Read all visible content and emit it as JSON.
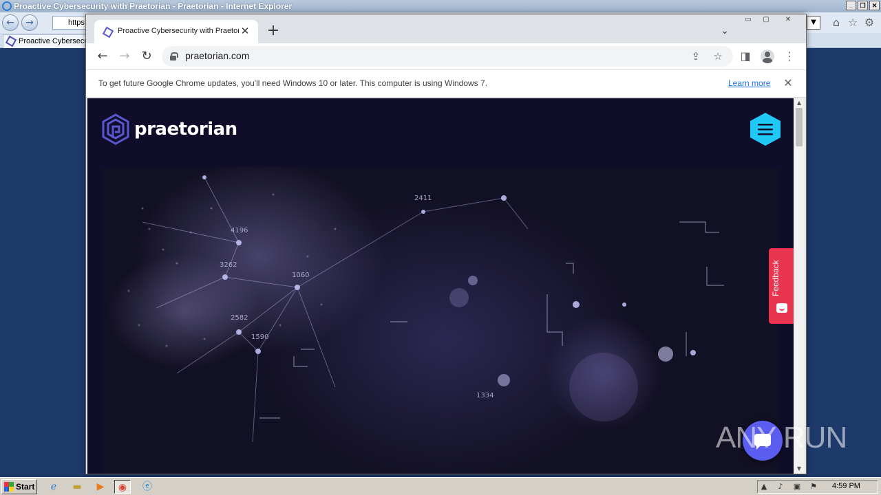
{
  "ie": {
    "title": "Proactive Cybersecurity with Praetorian - Praetorian - Internet Explorer",
    "address_value": "https",
    "tab_label": "Proactive Cybersecurity with Praetorian"
  },
  "chrome": {
    "tab_title": "Proactive Cybersecurity with Praetorian",
    "url": "praetorian.com",
    "infobar": {
      "message": "To get future Google Chrome updates, you'll need Windows 10 or later. This computer is using Windows 7.",
      "link": "Learn more"
    }
  },
  "site": {
    "logo_text": "praetorian",
    "brand_color": "#5b57d1",
    "menu_color": "#1fc8f5",
    "background": "#0f0d2a",
    "hero_numbers": [
      "2411",
      "4196",
      "3262",
      "1060",
      "2582",
      "1590",
      "1334"
    ]
  },
  "feedback": {
    "label": "Feedback",
    "color": "#e8344e"
  },
  "chat": {
    "icon": "chat-icon",
    "color": "#5b5cf0"
  },
  "watermark": "ANY RUN",
  "taskbar": {
    "start_label": "Start",
    "clock": "4:59 PM"
  }
}
